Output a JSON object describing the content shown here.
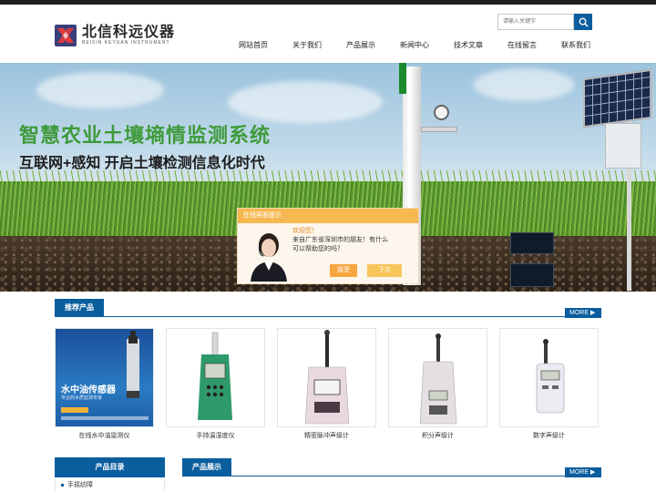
{
  "header": {
    "logo_cn": "北信科远仪器",
    "logo_en": "BEIXIN KEYUAN INSTRUMENT",
    "search_placeholder": "请输入关键字"
  },
  "nav": {
    "items": [
      "网站首页",
      "关于我们",
      "产品展示",
      "新闻中心",
      "技术文章",
      "在线留言",
      "联系我们"
    ]
  },
  "banner": {
    "title": "智慧农业土壤墒情监测系统",
    "subtitle": "互联网+感知   开启土壤检测信息化时代"
  },
  "chat": {
    "header": "在线客服提示",
    "line1": "欢迎您！",
    "line2": "来自广东省深圳市的朋友！有什么",
    "line3": "可以帮助您的吗？",
    "accept": "接受",
    "later": "下次"
  },
  "recommended": {
    "title": "推荐产品",
    "more": "MORE ▶",
    "products": [
      {
        "name": "在线水中油监测仪",
        "banner_title": "水中油传感器",
        "banner_sub": "专业的水质监测专家"
      },
      {
        "name": "手持温湿度仪"
      },
      {
        "name": "精密脉冲声级计"
      },
      {
        "name": "积分声级计"
      },
      {
        "name": "数字声级计"
      }
    ]
  },
  "catalog": {
    "title": "产品目录",
    "items": [
      "手摇纺障"
    ]
  },
  "showcase": {
    "title": "产品展示",
    "more": "MORE ▶"
  },
  "colors": {
    "brand_blue": "#0a5e9e",
    "banner_title_green": "#3e9a3a",
    "chat_orange": "#f6b851"
  }
}
